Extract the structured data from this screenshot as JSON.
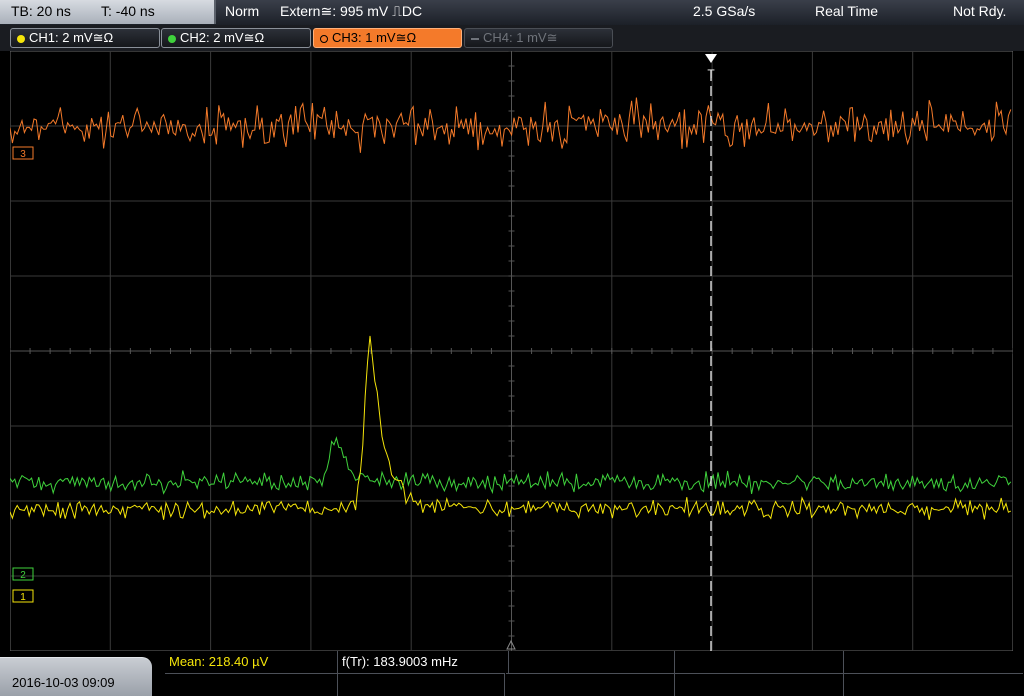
{
  "status": {
    "timebase": "TB: 20 ns",
    "trigger_time": "T: -40 ns",
    "mode": "Norm",
    "trigger_source": "Extern≅: 995 mV ⎍DC",
    "sample_rate": "2.5 GSa/s",
    "acq_mode": "Real Time",
    "state": "Not Rdy."
  },
  "channels": [
    {
      "label": "CH1: 2 mV≅Ω",
      "color": "#f5e50a",
      "state": "on"
    },
    {
      "label": "CH2: 2 mV≅Ω",
      "color": "#3fd23c",
      "state": "on"
    },
    {
      "label": "CH3: 1 mV≅Ω",
      "color": "#f47a2a",
      "state": "active"
    },
    {
      "label": "CH4: 1 mV≅",
      "color": "#6f737a",
      "state": "off"
    }
  ],
  "markers": {
    "trigger_marker": "T",
    "ch3_level": "3",
    "ch2_level": "2",
    "ch1_level": "1"
  },
  "measurements": {
    "mean": "Mean: 218.40 µV",
    "frequency": "f(Tr): 183.9003 mHz"
  },
  "datetime": "2016-10-03 09:09",
  "chart_data": {
    "type": "line",
    "grid": true,
    "divisions_x": 10,
    "divisions_y": 8,
    "series": [
      {
        "name": "CH3",
        "color": "#f47a2a",
        "baseline_div": 1.0,
        "noise_div": 0.4,
        "pulse": null
      },
      {
        "name": "CH2",
        "color": "#3fd23c",
        "baseline_div": 5.75,
        "noise_div": 0.18,
        "pulse": {
          "x_div": 3.25,
          "height_div": 0.55
        }
      },
      {
        "name": "CH1",
        "color": "#f5e50a",
        "baseline_div": 6.1,
        "noise_div": 0.18,
        "pulse": {
          "x_div": 3.6,
          "height_div": 2.3
        }
      }
    ]
  }
}
